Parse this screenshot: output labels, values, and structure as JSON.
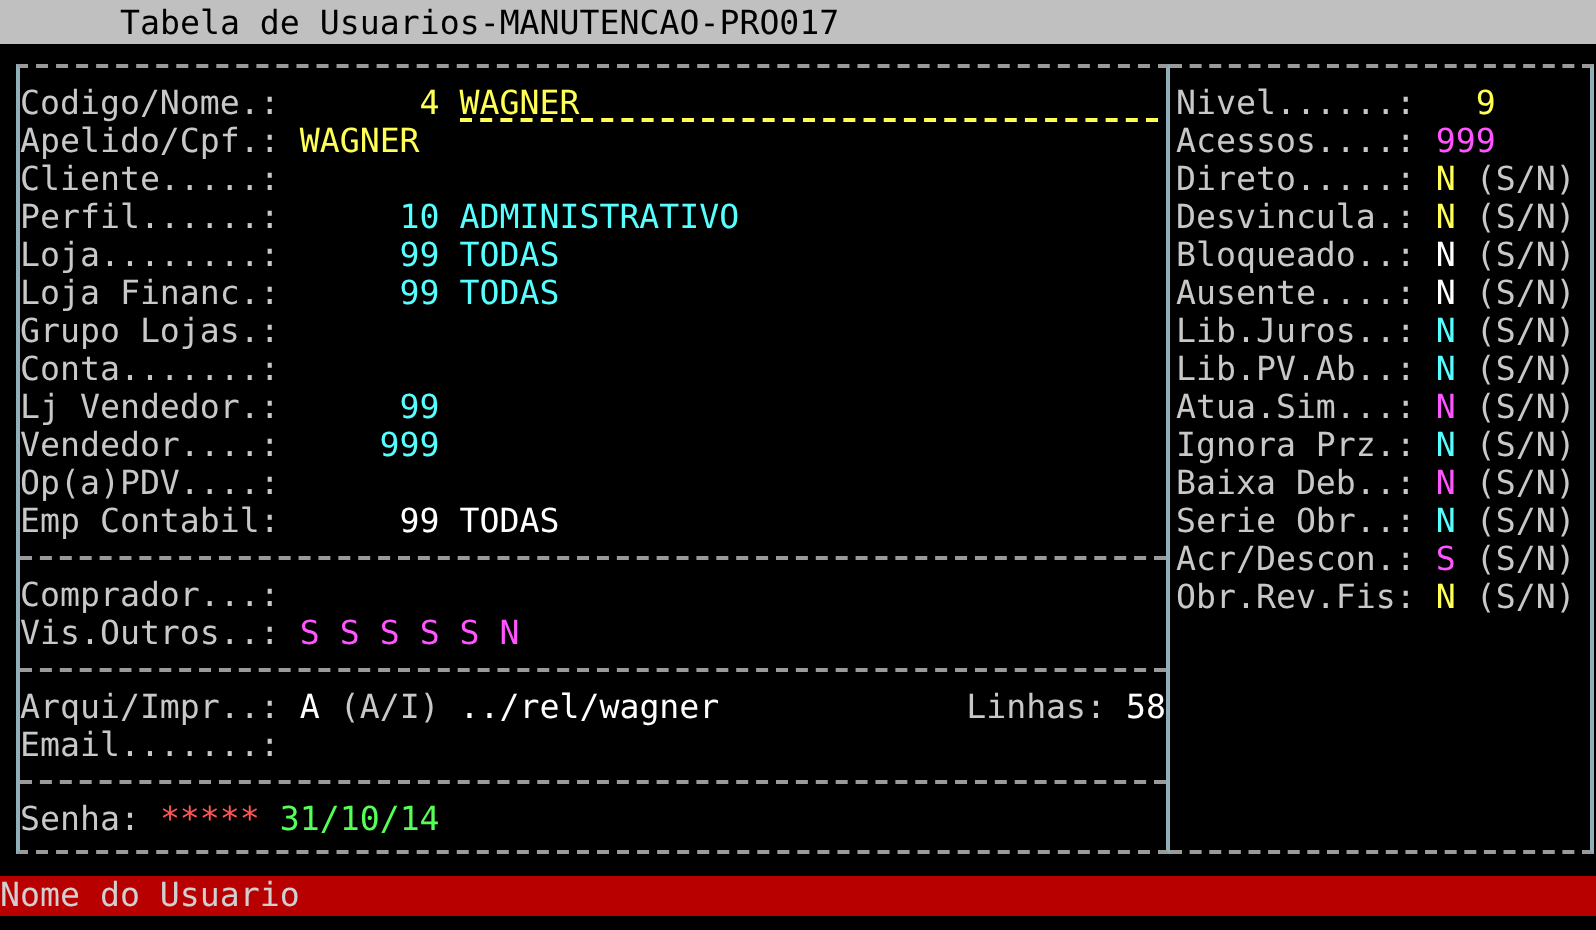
{
  "window": {
    "title": "Tabela de Usuarios-MANUTENCAO-PRO017"
  },
  "main_fields": [
    {
      "label": "Codigo/Nome.:",
      "kind": "input",
      "code": "4",
      "value": "WAGNER",
      "color": "#ffff55"
    },
    {
      "label": "Apelido/Cpf.:",
      "kind": "text",
      "value": "WAGNER",
      "color": "#ffff55"
    },
    {
      "label": "Cliente.....:",
      "kind": "empty"
    },
    {
      "label": "Perfil......:",
      "kind": "code",
      "code": "10",
      "value": "ADMINISTRATIVO",
      "color": "#55ffff"
    },
    {
      "label": "Loja........:",
      "kind": "code",
      "code": "99",
      "value": "TODAS",
      "color": "#55ffff"
    },
    {
      "label": "Loja Financ.:",
      "kind": "code",
      "code": "99",
      "value": "TODAS",
      "color": "#55ffff"
    },
    {
      "label": "Grupo Lojas.:",
      "kind": "empty"
    },
    {
      "label": "Conta.......:",
      "kind": "empty"
    },
    {
      "label": "Lj Vendedor.:",
      "kind": "code",
      "code": "99",
      "color": "#55ffff"
    },
    {
      "label": "Vendedor....:",
      "kind": "code",
      "code": "999",
      "color": "#55ffff"
    },
    {
      "label": "Op(a)PDV....:",
      "kind": "empty"
    },
    {
      "label": "Emp Contabil:",
      "kind": "code",
      "code": "99",
      "value": "TODAS",
      "color": "#ffffff"
    }
  ],
  "buyer_section": [
    {
      "label": "Comprador...:",
      "kind": "empty"
    },
    {
      "label": "Vis.Outros..:",
      "kind": "flags",
      "flags": [
        {
          "value": "S",
          "color": "#ff55ff"
        },
        {
          "value": "S",
          "color": "#ff55ff"
        },
        {
          "value": "S",
          "color": "#ff55ff"
        },
        {
          "value": "S",
          "color": "#ff55ff"
        },
        {
          "value": "S",
          "color": "#ff55ff"
        },
        {
          "value": "N",
          "color": "#ff55ff"
        }
      ]
    }
  ],
  "output_section": {
    "mode_label": "Arqui/Impr..:",
    "mode": "A",
    "mode_hint": "(A/I)",
    "path": "../rel/wagner",
    "lines_label": "Linhas:",
    "lines": "58",
    "email_label": "Email.......:"
  },
  "password_section": {
    "label": "Senha:",
    "password": "*****",
    "date": "31/10/14"
  },
  "options": [
    {
      "label": "Nivel......:",
      "kind": "number",
      "value": "9",
      "color": "#ffff55"
    },
    {
      "label": "Acessos....:",
      "kind": "number",
      "value": "999",
      "color": "#ff55ff"
    },
    {
      "label": "Direto.....:",
      "kind": "flag",
      "value": "N",
      "hint": "(S/N)",
      "color": "#ffff55"
    },
    {
      "label": "Desvincula.:",
      "kind": "flag",
      "value": "N",
      "hint": "(S/N)",
      "color": "#ffff55"
    },
    {
      "label": "Bloqueado..:",
      "kind": "flag",
      "value": "N",
      "hint": "(S/N)",
      "color": "#ffffff"
    },
    {
      "label": "Ausente....:",
      "kind": "flag",
      "value": "N",
      "hint": "(S/N)",
      "color": "#ffffff"
    },
    {
      "label": "Lib.Juros..:",
      "kind": "flag",
      "value": "N",
      "hint": "(S/N)",
      "color": "#55ffff"
    },
    {
      "label": "Lib.PV.Ab..:",
      "kind": "flag",
      "value": "N",
      "hint": "(S/N)",
      "color": "#55ffff"
    },
    {
      "label": "Atua.Sim...:",
      "kind": "flag",
      "value": "N",
      "hint": "(S/N)",
      "color": "#ff55ff"
    },
    {
      "label": "Ignora Prz.:",
      "kind": "flag",
      "value": "N",
      "hint": "(S/N)",
      "color": "#55ffff"
    },
    {
      "label": "Baixa Deb..:",
      "kind": "flag",
      "value": "N",
      "hint": "(S/N)",
      "color": "#ff55ff"
    },
    {
      "label": "Serie Obr..:",
      "kind": "flag",
      "value": "N",
      "hint": "(S/N)",
      "color": "#55ffff"
    },
    {
      "label": "Acr/Descon.:",
      "kind": "flag",
      "value": "S",
      "hint": "(S/N)",
      "color": "#ff55ff"
    },
    {
      "label": "Obr.Rev.Fis:",
      "kind": "flag",
      "value": "N",
      "hint": "(S/N)",
      "color": "#ffff55"
    }
  ],
  "status_bar": {
    "text": "Nome do Usuario"
  }
}
